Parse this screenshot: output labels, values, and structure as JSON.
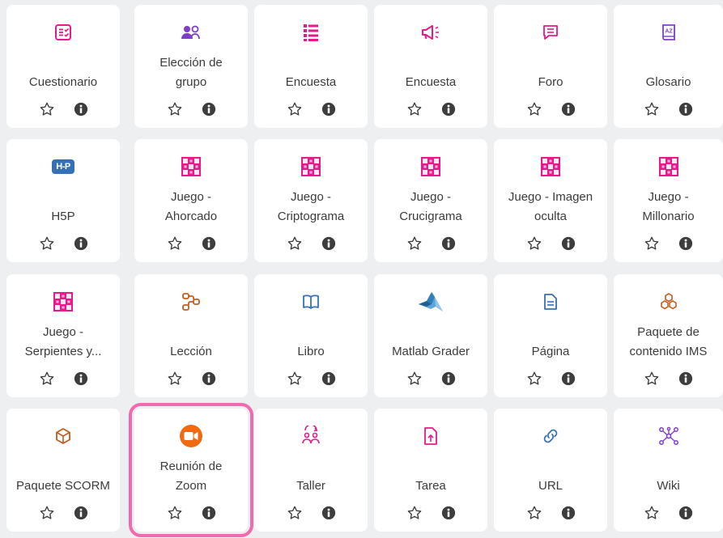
{
  "colors": {
    "pink": "#e8198b",
    "purple": "#7e3ec9",
    "orange": "#c35d20",
    "blue": "#3570b8",
    "zoom": "#ef6a10",
    "highlight": "#f06ab0"
  },
  "tiles": [
    {
      "name": "cuestionario",
      "icon": "quiz-icon",
      "lines": [
        "Cuestionario"
      ]
    },
    {
      "name": "eleccion-de-grupo",
      "icon": "group-choice-icon",
      "lines": [
        "Elección de",
        "grupo"
      ]
    },
    {
      "name": "encuesta-1",
      "icon": "survey-list-icon",
      "lines": [
        "Encuesta"
      ]
    },
    {
      "name": "encuesta-2",
      "icon": "megaphone-icon",
      "lines": [
        "Encuesta"
      ]
    },
    {
      "name": "foro",
      "icon": "chat-bubble-icon",
      "lines": [
        "Foro"
      ]
    },
    {
      "name": "glosario",
      "icon": "glossary-book-icon",
      "lines": [
        "Glosario"
      ]
    },
    {
      "name": "h5p",
      "icon": "h5p-icon",
      "badge": "H-P",
      "lines": [
        "H5P"
      ]
    },
    {
      "name": "juego-ahorcado",
      "icon": "game-board-icon",
      "lines": [
        "Juego -",
        "Ahorcado"
      ]
    },
    {
      "name": "juego-criptograma",
      "icon": "game-board-icon",
      "lines": [
        "Juego -",
        "Criptograma"
      ]
    },
    {
      "name": "juego-crucigrama",
      "icon": "game-board-icon",
      "lines": [
        "Juego -",
        "Crucigrama"
      ]
    },
    {
      "name": "juego-imagen-oculta",
      "icon": "game-board-icon",
      "lines": [
        "Juego - Imagen",
        "oculta"
      ]
    },
    {
      "name": "juego-millonario",
      "icon": "game-board-icon",
      "lines": [
        "Juego -",
        "Millonario"
      ]
    },
    {
      "name": "juego-serpientes",
      "icon": "game-board-icon",
      "lines": [
        "Juego -",
        "Serpientes y..."
      ]
    },
    {
      "name": "leccion",
      "icon": "lesson-flow-icon",
      "lines": [
        "Lección"
      ]
    },
    {
      "name": "libro",
      "icon": "open-book-icon",
      "lines": [
        "Libro"
      ]
    },
    {
      "name": "matlab-grader",
      "icon": "matlab-icon",
      "lines": [
        "Matlab Grader"
      ]
    },
    {
      "name": "pagina",
      "icon": "page-document-icon",
      "lines": [
        "Página"
      ]
    },
    {
      "name": "paquete-ims",
      "icon": "cubes-package-icon",
      "lines": [
        "Paquete de",
        "contenido IMS"
      ]
    },
    {
      "name": "paquete-scorm",
      "icon": "scorm-package-icon",
      "lines": [
        "Paquete SCORM"
      ]
    },
    {
      "name": "reunion-zoom",
      "icon": "zoom-camera-icon",
      "lines": [
        "Reunión de",
        "Zoom"
      ],
      "highlight": true
    },
    {
      "name": "taller",
      "icon": "workshop-people-icon",
      "lines": [
        "Taller"
      ]
    },
    {
      "name": "tarea",
      "icon": "assignment-upload-icon",
      "lines": [
        "Tarea"
      ]
    },
    {
      "name": "url",
      "icon": "link-icon",
      "lines": [
        "URL"
      ]
    },
    {
      "name": "wiki",
      "icon": "wiki-network-icon",
      "lines": [
        "Wiki"
      ]
    }
  ]
}
